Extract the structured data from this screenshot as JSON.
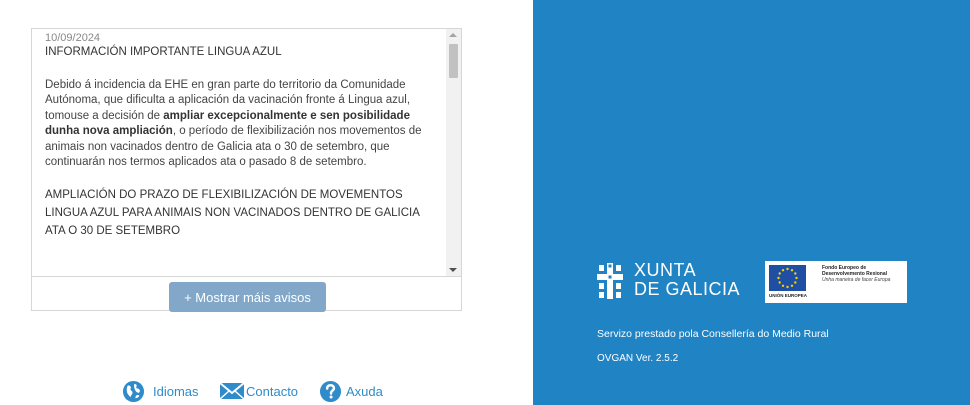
{
  "notice": {
    "date": "10/09/2024",
    "title": "INFORMACIÓN IMPORTANTE LINGUA AZUL",
    "paragraph_part1": "Debido á incidencia da EHE en gran parte do territorio da Comunidade Autónoma, que dificulta a aplicación da vacinación fronte á Lingua azul, tomouse a decisión de ",
    "paragraph_bold": "ampliar excepcionalmente e sen posibilidade dunha nova ampliación",
    "paragraph_part2": ", o período de flexibilización nos movementos de animais non vacinados dentro de Galicia ata o 30 de setembro, que continuarán nos termos aplicados ata o pasado 8 de setembro.",
    "second_title": "AMPLIACIÓN DO PRAZO DE FLEXIBILIZACIÓN DE MOVEMENTOS LINGUA AZUL PARA ANIMAIS NON VACINADOS DENTRO DE GALICIA ATA O 30 DE SETEMBRO"
  },
  "more_button": {
    "label": "+ Mostrar máis avisos"
  },
  "footer": {
    "languages_label": "Idiomas",
    "contact_label": "Contacto",
    "help_label": "Axuda"
  },
  "branding": {
    "xunta_line1": "XUNTA",
    "xunta_line2": "DE GALICIA",
    "eu_fund_line1": "Fondo Europeo de",
    "eu_fund_line2": "Desenvolvemento Rexional",
    "eu_fund_line3": "Unha maneira de facer Europa",
    "eu_caption": "UNIÓN EUROPEA",
    "service_text": "Servizo prestado pola Consellería do Medio Rural",
    "version_text": "OVGAN Ver. 2.5.2"
  },
  "colors": {
    "brand_blue": "#1f83c4",
    "button_blue": "#82a7c9",
    "link_blue": "#2f8bc9"
  },
  "icons": [
    "globe-icon",
    "envelope-icon",
    "help-icon",
    "xunta-emblem-icon",
    "eu-flag-icon"
  ]
}
